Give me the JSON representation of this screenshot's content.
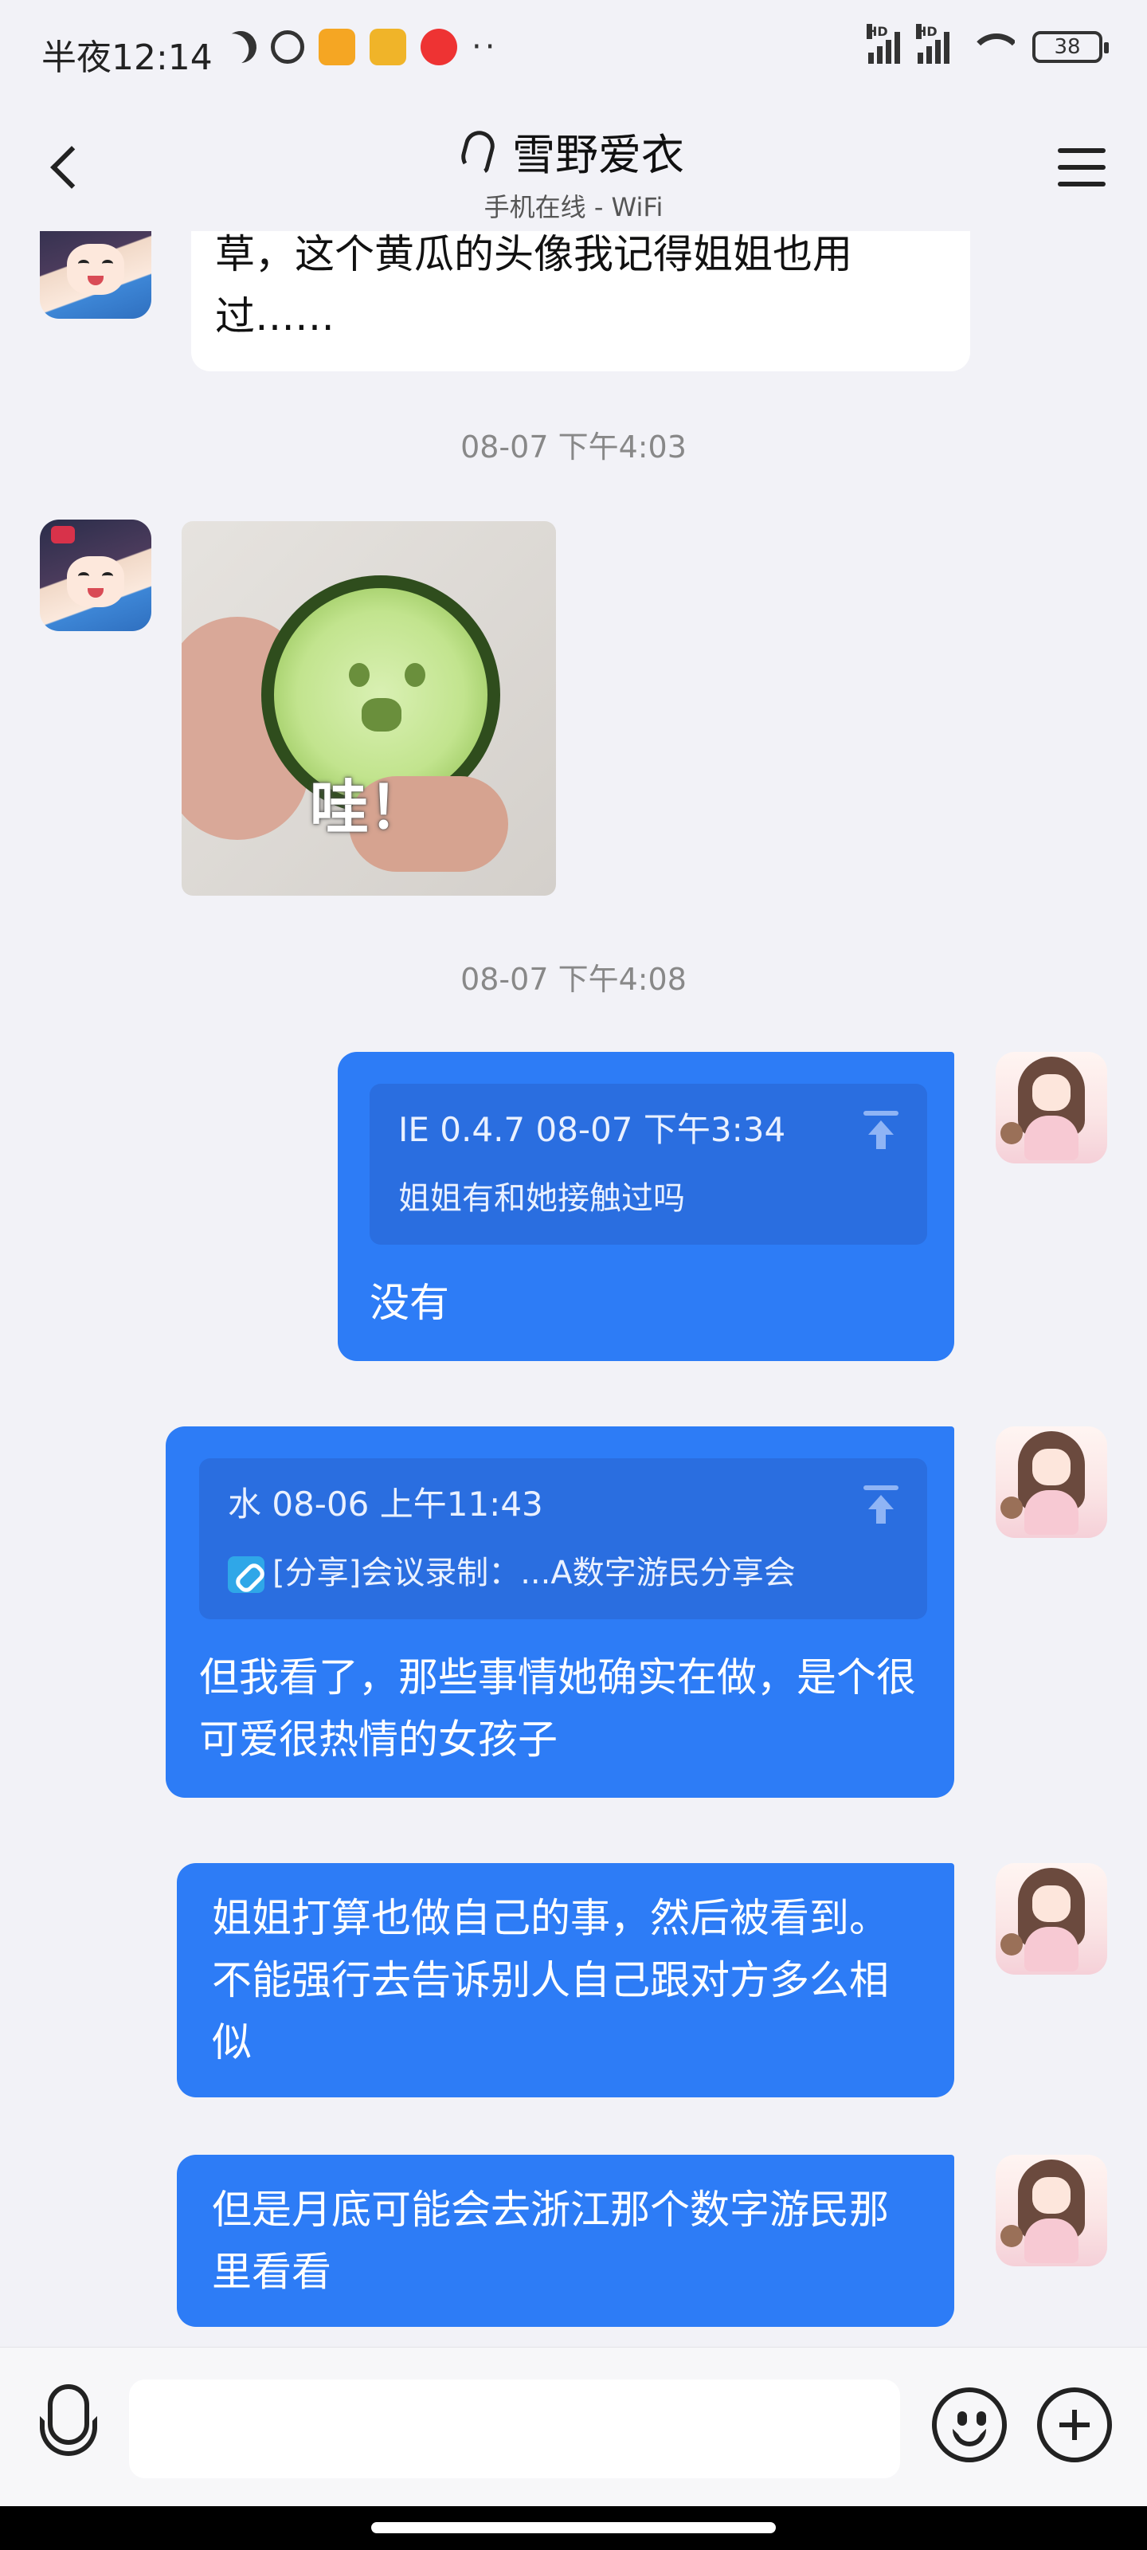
{
  "status_bar": {
    "time": "半夜12:14",
    "battery": "38",
    "hd_label": "HD",
    "extra": "··"
  },
  "header": {
    "back_icon": "chevron-left-icon",
    "mode_icon": "ear-icon",
    "title": "雪野爱衣",
    "subtitle": "手机在线 - WiFi",
    "menu_icon": "hamburger-menu-icon"
  },
  "messages": [
    {
      "side": "left",
      "type": "text",
      "text": "草，这个黄瓜的头像我记得姐姐也用过……"
    },
    {
      "type": "timestamp",
      "text": "08-07 下午4:03"
    },
    {
      "side": "left",
      "type": "sticker",
      "caption": "哇！"
    },
    {
      "type": "timestamp",
      "text": "08-07 下午4:08"
    },
    {
      "side": "right",
      "type": "reply",
      "quote_head": "IE 0.4.7 08-07 下午3:34",
      "quote_body": "姐姐有和她接触过吗",
      "text": "没有"
    },
    {
      "side": "right",
      "type": "reply",
      "quote_head": "水 08-06 上午11:43",
      "quote_body": "[分享]会议录制：...A数字游民分享会",
      "text": "但我看了，那些事情她确实在做，是个很可爱很热情的女孩子"
    },
    {
      "side": "right",
      "type": "text",
      "text": "姐姐打算也做自己的事，然后被看到。不能强行去告诉别人自己跟对方多么相似"
    },
    {
      "side": "right",
      "type": "text",
      "text": "但是月底可能会去浙江那个数字游民那里看看"
    }
  ],
  "input_bar": {
    "voice_icon": "microphone-icon",
    "placeholder": "",
    "emoji_icon": "emoji-icon",
    "plus_icon": "plus-icon"
  },
  "colors": {
    "accent": "#2d7cf6",
    "quote": "#2a6ee0",
    "background": "#f2f2f7"
  }
}
